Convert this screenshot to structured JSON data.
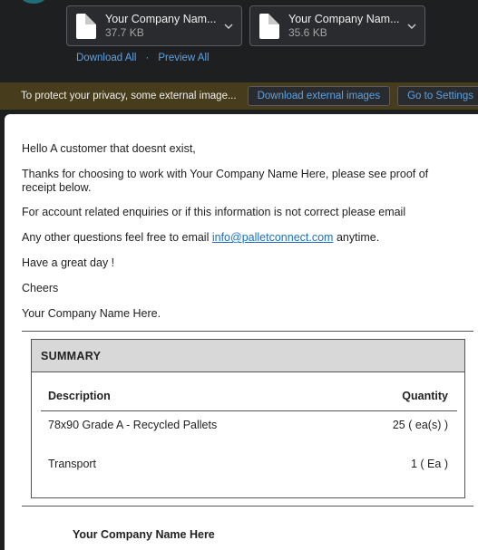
{
  "attachments": [
    {
      "name": "Your Company Nam...",
      "size": "37.7 KB"
    },
    {
      "name": "Your Company Nam...",
      "size": "35.6 KB"
    }
  ],
  "attachment_actions": {
    "download_all": "Download All",
    "separator": "·",
    "preview_all": "Preview All"
  },
  "privacy_bar": {
    "message": "To protect your privacy, some external image...",
    "download_button": "Download external images",
    "settings_button": "Go to Settings"
  },
  "email_body": {
    "greeting": "Hello A customer that doesnt exist,",
    "thanks": "Thanks for choosing to work with Your Company Name Here, please see proof of receipt below.",
    "account_line": "For account related enquiries or if this information is not correct please email",
    "questions_prefix": "Any other questions feel free to email",
    "questions_email": "info@palletconnect.com",
    "questions_suffix": "anytime.",
    "have_day": "Have a great day !",
    "cheers": "Cheers",
    "signature": "Your Company Name Here."
  },
  "summary": {
    "title": "SUMMARY",
    "columns": {
      "description": "Description",
      "quantity": "Quantity"
    },
    "rows": [
      {
        "description": "78x90 Grade A - Recycled Pallets",
        "quantity": "25 ( ea(s) )"
      },
      {
        "description": "Transport",
        "quantity": "1 ( Ea )"
      }
    ]
  },
  "footer": {
    "company": "Your Company Name Here"
  },
  "colors": {
    "link": "#5aa2e6",
    "privacy_bar": "#473c1c",
    "email_link": "#1a6fc4"
  }
}
